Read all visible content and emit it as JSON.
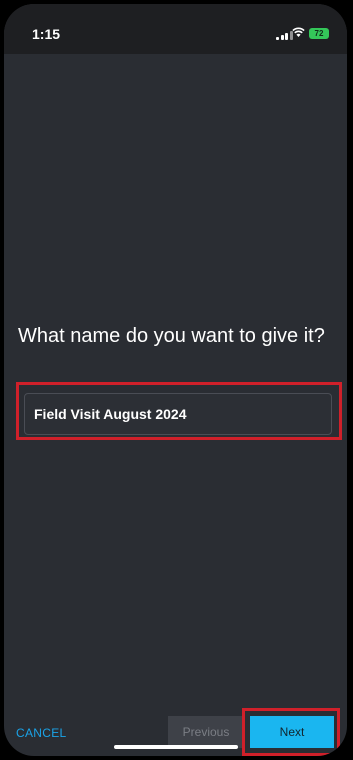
{
  "status_bar": {
    "time": "1:15",
    "battery": "72"
  },
  "main": {
    "question": "What name do you want to give it?",
    "name_value": "Field Visit August 2024"
  },
  "footer": {
    "cancel_label": "CANCEL",
    "previous_label": "Previous",
    "next_label": "Next"
  },
  "colors": {
    "accent": "#1ab6f0",
    "highlight": "#d0202a",
    "background": "#2a2d33"
  }
}
